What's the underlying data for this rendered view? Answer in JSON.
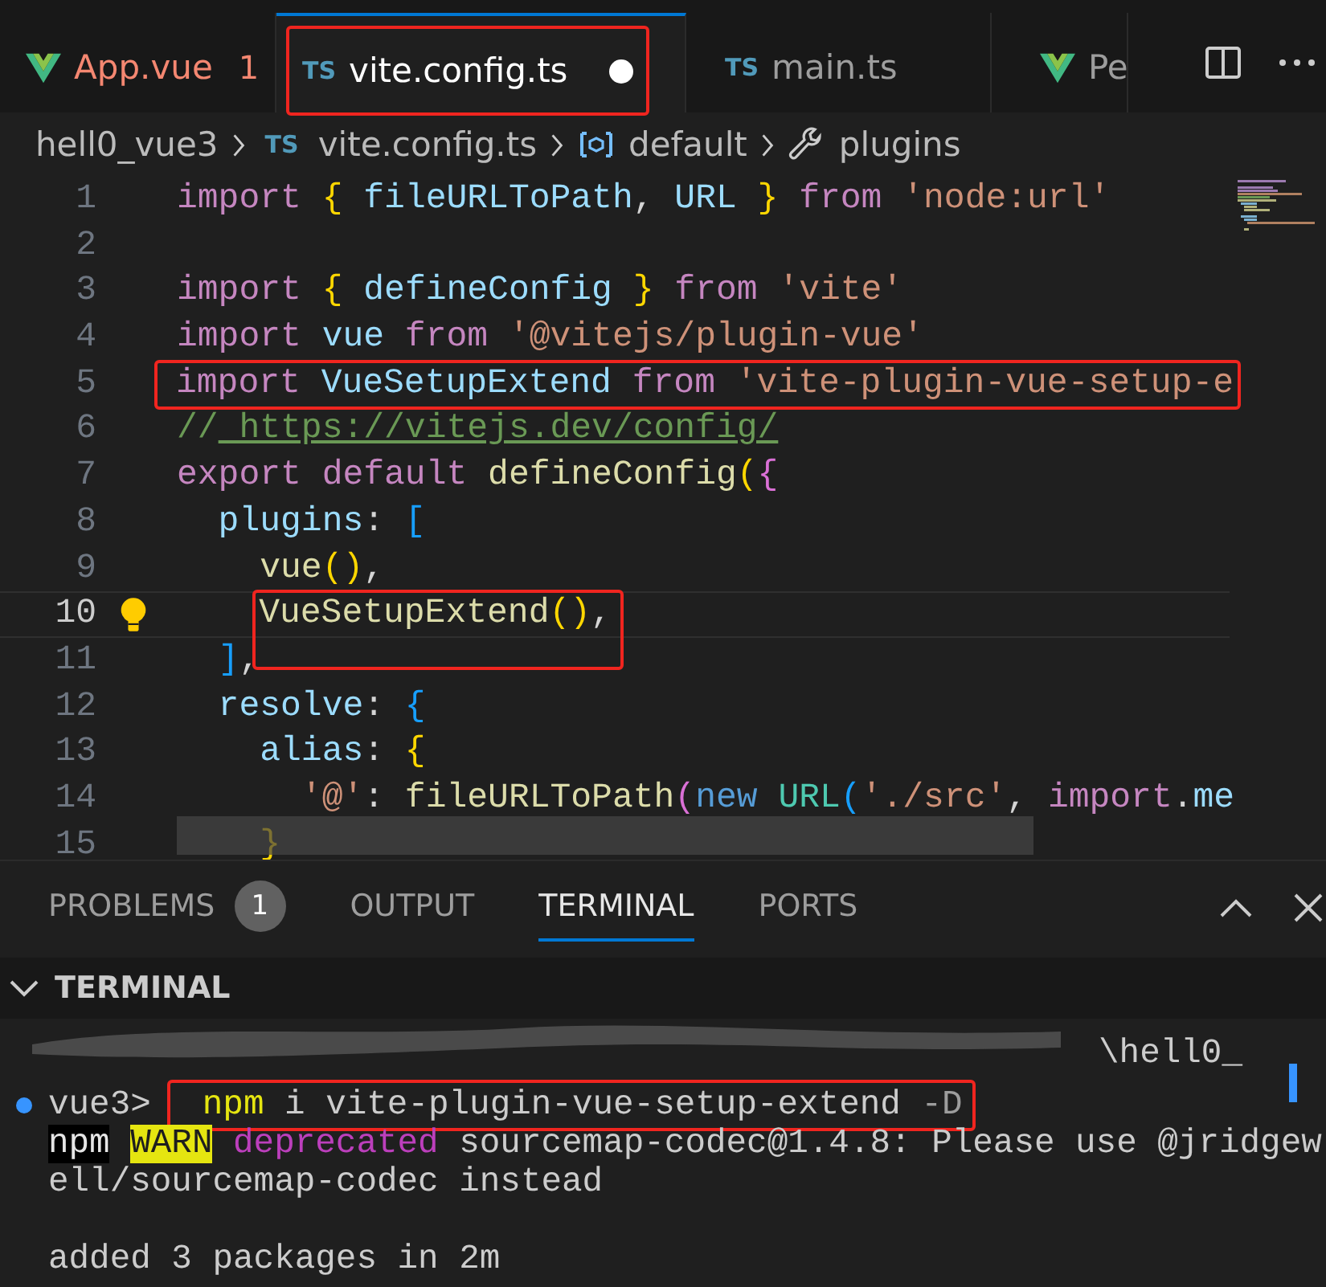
{
  "tabs": [
    {
      "kind": "vue",
      "label": "App.vue",
      "problems": "1",
      "error": true,
      "selected": false,
      "modified": false,
      "annotated": false
    },
    {
      "kind": "ts",
      "badge": "TS",
      "label": "vite.config.ts",
      "error": false,
      "selected": true,
      "modified": true,
      "annotated": true
    },
    {
      "kind": "ts",
      "badge": "TS",
      "label": "main.ts",
      "error": false,
      "selected": false,
      "modified": false,
      "annotated": false
    },
    {
      "kind": "vue",
      "label": "Pe",
      "error": false,
      "selected": false,
      "modified": false,
      "annotated": false
    }
  ],
  "breadcrumb": [
    {
      "kind": "folder",
      "text": "hell0_vue3"
    },
    {
      "kind": "ts",
      "badge": "TS",
      "text": "vite.config.ts"
    },
    {
      "kind": "symbol",
      "text": "default"
    },
    {
      "kind": "wrench",
      "text": "plugins"
    }
  ],
  "code_lines": [
    {
      "number": "1",
      "current": false,
      "lightbulb": false,
      "annotated": false,
      "tokens": [
        {
          "kind": "keyword",
          "text": "import"
        },
        {
          "kind": "bracket",
          "text": " {"
        },
        {
          "kind": "variable",
          "text": " fileURLToPath"
        },
        {
          "kind": "plain",
          "text": ","
        },
        {
          "kind": "variable",
          "text": " URL"
        },
        {
          "kind": "bracket",
          "text": " }"
        },
        {
          "kind": "keyword",
          "text": " from"
        },
        {
          "kind": "string",
          "text": " 'node:url'"
        }
      ]
    },
    {
      "number": "2",
      "current": false,
      "lightbulb": false
    },
    {
      "number": "3",
      "current": false,
      "lightbulb": false,
      "annotated": false,
      "tokens": [
        {
          "kind": "keyword",
          "text": "import"
        },
        {
          "kind": "bracket",
          "text": " {"
        },
        {
          "kind": "variable",
          "text": " defineConfig"
        },
        {
          "kind": "bracket",
          "text": " }"
        },
        {
          "kind": "keyword",
          "text": " from"
        },
        {
          "kind": "string",
          "text": " 'vite'"
        }
      ]
    },
    {
      "number": "4",
      "current": false,
      "lightbulb": false,
      "annotated": false,
      "tokens": [
        {
          "kind": "keyword",
          "text": "import"
        },
        {
          "kind": "variable",
          "text": " vue"
        },
        {
          "kind": "keyword",
          "text": " from"
        },
        {
          "kind": "string",
          "text": " '@vitejs/plugin-vue'"
        }
      ]
    },
    {
      "number": "5",
      "current": false,
      "lightbulb": false,
      "annotated": true,
      "tokens": [
        {
          "kind": "keyword",
          "text": "import"
        },
        {
          "kind": "variable",
          "text": " VueSetupExtend"
        },
        {
          "kind": "keyword",
          "text": " from"
        },
        {
          "kind": "string",
          "text": " 'vite-plugin-vue-setup-e"
        }
      ]
    },
    {
      "number": "6",
      "current": false,
      "lightbulb": false,
      "annotated": false,
      "tokens": [
        {
          "kind": "comment",
          "text": "//"
        },
        {
          "kind": "link",
          "text": " https://vitejs.dev/config/"
        }
      ]
    },
    {
      "number": "7",
      "current": false,
      "lightbulb": false,
      "annotated": false,
      "tokens": [
        {
          "kind": "keyword",
          "text": "export default"
        },
        {
          "kind": "function",
          "text": " defineConfig"
        },
        {
          "kind": "bracket",
          "text": "("
        },
        {
          "kind": "bracket2",
          "text": "{"
        }
      ]
    },
    {
      "number": "8",
      "current": false,
      "lightbulb": false,
      "annotated": false,
      "tokens": [
        {
          "kind": "variable",
          "text": "  plugins"
        },
        {
          "kind": "plain",
          "text": ":"
        },
        {
          "kind": "bracket3",
          "text": " ["
        }
      ]
    },
    {
      "number": "9",
      "current": false,
      "lightbulb": false,
      "annotated": false,
      "tokens": [
        {
          "kind": "function",
          "text": "    vue"
        },
        {
          "kind": "bracket",
          "text": "()"
        },
        {
          "kind": "plain",
          "text": ","
        }
      ]
    },
    {
      "number": "10",
      "current": true,
      "lightbulb": true,
      "annotated": true,
      "tokens": [
        {
          "kind": "function",
          "text": "VueSetupExtend"
        },
        {
          "kind": "bracket",
          "text": "()"
        },
        {
          "kind": "plain",
          "text": ","
        }
      ]
    },
    {
      "number": "11",
      "current": false,
      "lightbulb": false,
      "annotated": false,
      "tokens": [
        {
          "kind": "bracket3",
          "text": "  ]"
        },
        {
          "kind": "plain",
          "text": ","
        }
      ]
    },
    {
      "number": "12",
      "current": false,
      "lightbulb": false,
      "annotated": false,
      "tokens": [
        {
          "kind": "variable",
          "text": "  resolve"
        },
        {
          "kind": "plain",
          "text": ":"
        },
        {
          "kind": "bracket3",
          "text": " {"
        }
      ]
    },
    {
      "number": "13",
      "current": false,
      "lightbulb": false,
      "annotated": false,
      "tokens": [
        {
          "kind": "variable",
          "text": "    alias"
        },
        {
          "kind": "plain",
          "text": ":"
        },
        {
          "kind": "bracket",
          "text": " {"
        }
      ]
    },
    {
      "number": "14",
      "current": false,
      "lightbulb": false,
      "annotated": false,
      "tokens": [
        {
          "kind": "string",
          "text": "      '@'"
        },
        {
          "kind": "plain",
          "text": ":"
        },
        {
          "kind": "function",
          "text": " fileURLToPath"
        },
        {
          "kind": "bracket2",
          "text": "("
        },
        {
          "kind": "new",
          "text": "new"
        },
        {
          "kind": "class",
          "text": " URL"
        },
        {
          "kind": "bracket3",
          "text": "("
        },
        {
          "kind": "string",
          "text": "'./src'"
        },
        {
          "kind": "plain",
          "text": ","
        },
        {
          "kind": "keyword",
          "text": " import"
        },
        {
          "kind": "plain",
          "text": "."
        },
        {
          "kind": "variable",
          "text": "me"
        }
      ]
    },
    {
      "number": "15",
      "current": false,
      "lightbulb": false,
      "annotated": false,
      "tokens": [
        {
          "kind": "bracket",
          "text": "    }"
        }
      ]
    }
  ],
  "panel_tabs": [
    {
      "label": "PROBLEMS",
      "count": "1",
      "selected": false
    },
    {
      "label": "OUTPUT",
      "selected": false
    },
    {
      "label": "TERMINAL",
      "selected": true
    },
    {
      "label": "PORTS",
      "selected": false
    }
  ],
  "terminal": {
    "title": "TERMINAL",
    "expanded": true,
    "lines": [
      {
        "redacted": true,
        "prompt_dot": false,
        "tokens": [
          {
            "kind": "plain",
            "text": "\\hell0_"
          }
        ]
      },
      {
        "redacted": false,
        "prompt_dot": true,
        "tokens": [
          {
            "kind": "plain",
            "text": "vue3>"
          },
          {
            "kind": "command",
            "text": "npm",
            "annotated": true
          },
          {
            "kind": "plain",
            "text": " i vite-plugin-vue-setup-extend",
            "annotated": true
          },
          {
            "kind": "flag",
            "text": " -D",
            "annotated": true
          }
        ]
      },
      {
        "redacted": false,
        "prompt_dot": false,
        "tokens": [
          {
            "kind": "inverse",
            "text": "npm"
          },
          {
            "kind": "warning",
            "text": "WARN"
          },
          {
            "kind": "deprecated",
            "text": "deprecated"
          },
          {
            "kind": "plain",
            "text": "sourcemap-codec@1.4.8: Please use @jridgew"
          }
        ]
      },
      {
        "redacted": false,
        "prompt_dot": false,
        "tokens": [
          {
            "kind": "plain",
            "text": "ell/sourcemap-codec instead"
          }
        ]
      },
      {
        "redacted": false,
        "prompt_dot": false
      },
      {
        "redacted": false,
        "prompt_dot": false,
        "tokens": [
          {
            "kind": "plain",
            "text": "added 3 packages in 2m"
          }
        ]
      }
    ]
  }
}
